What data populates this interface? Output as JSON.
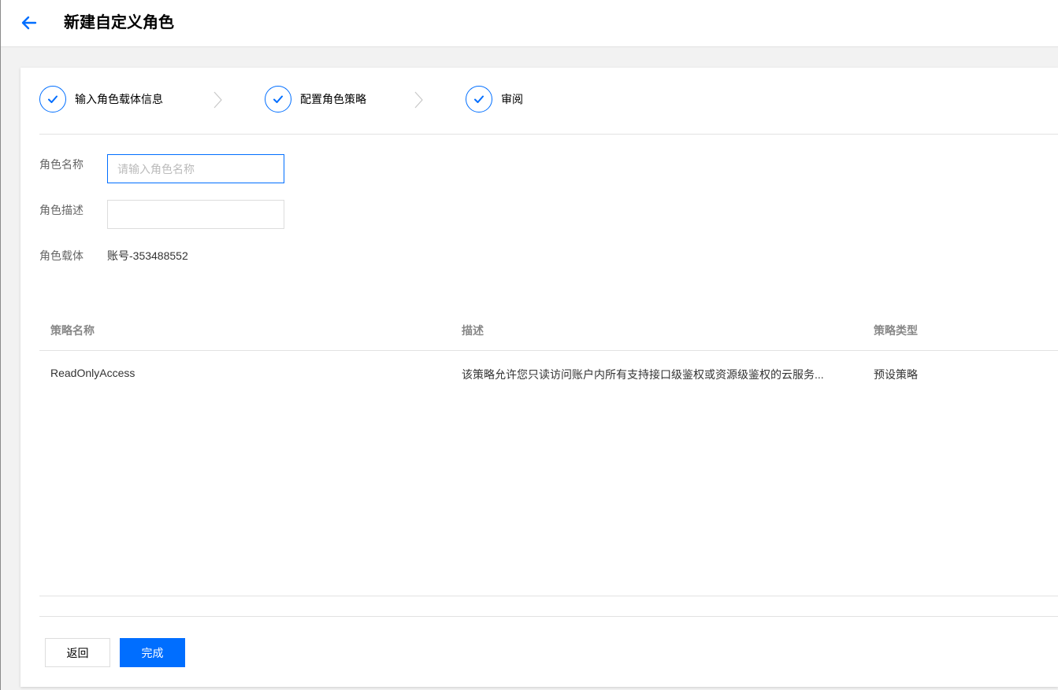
{
  "header": {
    "title": "新建自定义角色",
    "back_icon": "arrow-left-icon",
    "accent_color": "#006eff"
  },
  "steps": [
    {
      "label": "输入角色载体信息",
      "status": "done"
    },
    {
      "label": "配置角色策略",
      "status": "done"
    },
    {
      "label": "审阅",
      "status": "done"
    }
  ],
  "form": {
    "name_label": "角色名称",
    "name_placeholder": "请输入角色名称",
    "name_value": "",
    "desc_label": "角色描述",
    "desc_value": "",
    "carrier_label": "角色载体",
    "carrier_value": "账号-353488552"
  },
  "table": {
    "columns": [
      "策略名称",
      "描述",
      "策略类型"
    ],
    "rows": [
      {
        "name": "ReadOnlyAccess",
        "description": "该策略允许您只读访问账户内所有支持接口级鉴权或资源级鉴权的云服务...",
        "type": "预设策略"
      }
    ]
  },
  "footer": {
    "back_label": "返回",
    "done_label": "完成"
  }
}
